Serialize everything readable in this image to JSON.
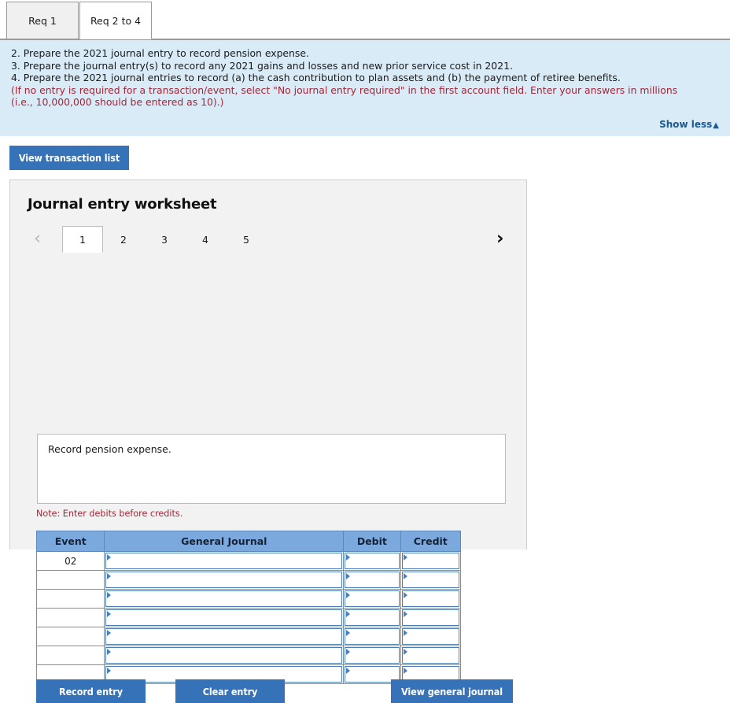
{
  "tabs": [
    {
      "label": "Req 1",
      "active": false
    },
    {
      "label": "Req 2 to 4",
      "active": true
    }
  ],
  "instructions": {
    "lines": [
      {
        "text": "2. Prepare the 2021 journal entry to record pension expense.",
        "style": "normal"
      },
      {
        "text": "3. Prepare the journal entry(s) to record any 2021 gains and losses and new prior service cost in 2021.",
        "style": "normal"
      },
      {
        "text": "4. Prepare the 2021 journal entries to record (a) the cash contribution to plan assets and (b) the payment of retiree benefits.",
        "style": "normal"
      },
      {
        "text": "(If no entry is required for a transaction/event, select \"No journal entry required\" in the first account field. Enter your answers in millions",
        "style": "red"
      },
      {
        "text": "(i.e., 10,000,000 should be entered as 10).)",
        "style": "red"
      }
    ],
    "show_less_label": "Show less",
    "show_less_caret": "▲"
  },
  "toolbar": {
    "view_transaction_list_label": "View transaction list"
  },
  "worksheet": {
    "title": "Journal entry worksheet",
    "prev_chevron": "‹",
    "next_chevron": "›",
    "entry_tabs": [
      {
        "label": "1",
        "active": true
      },
      {
        "label": "2",
        "active": false
      },
      {
        "label": "3",
        "active": false
      },
      {
        "label": "4",
        "active": false
      },
      {
        "label": "5",
        "active": false
      }
    ],
    "description": "Record pension expense.",
    "note": "Note: Enter debits before credits.",
    "table": {
      "headers": [
        "Event",
        "General Journal",
        "Debit",
        "Credit"
      ],
      "rows": [
        {
          "event": "02",
          "general_journal": "",
          "debit": "",
          "credit": ""
        },
        {
          "event": "",
          "general_journal": "",
          "debit": "",
          "credit": ""
        },
        {
          "event": "",
          "general_journal": "",
          "debit": "",
          "credit": ""
        },
        {
          "event": "",
          "general_journal": "",
          "debit": "",
          "credit": ""
        },
        {
          "event": "",
          "general_journal": "",
          "debit": "",
          "credit": ""
        },
        {
          "event": "",
          "general_journal": "",
          "debit": "",
          "credit": ""
        },
        {
          "event": "",
          "general_journal": "",
          "debit": "",
          "credit": ""
        }
      ]
    },
    "actions": {
      "record_entry_label": "Record entry",
      "clear_entry_label": "Clear entry",
      "view_general_journal_label": "View general journal"
    }
  },
  "colors": {
    "primary_button": "#3572b8",
    "table_header": "#7ba9dd",
    "instruction_panel": "#d9ebf7",
    "alert_text": "#a32638",
    "link": "#1b5a92"
  }
}
